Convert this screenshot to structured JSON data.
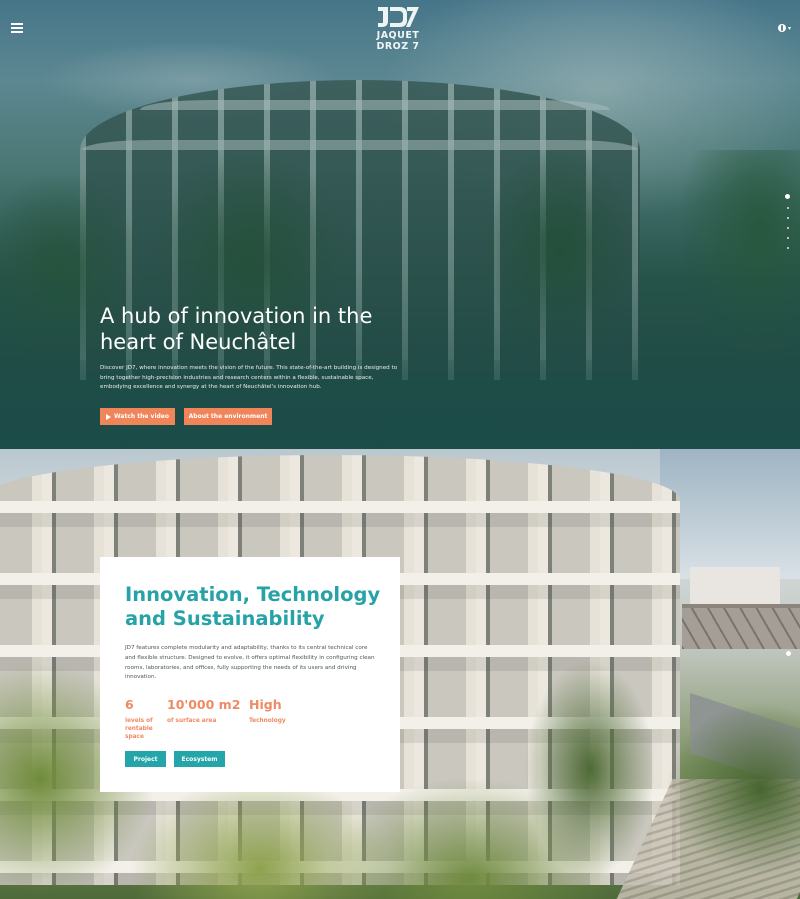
{
  "header": {
    "logo_text_line1": "JAQUET",
    "logo_text_line2": "DROZ 7",
    "menu_icon": "hamburger-menu-icon",
    "language_icon": "globe-icon"
  },
  "hero": {
    "title": "A hub of innovation in the heart of Neuchâtel",
    "description": "Discover JD7, where innovation meets the vision of the future. This state-of-the-art building is designed to bring together high-precision industries and research centers within a flexible, sustainable space, embodying excellence and synergy at the heart of Neuchâtel's innovation hub.",
    "buttons": [
      {
        "label": "Watch the video",
        "icon": "play-icon"
      },
      {
        "label": "About the environment"
      }
    ],
    "slide_count": 6,
    "active_slide": 1
  },
  "innovation": {
    "title": "Innovation, Technology and Sustainability",
    "text": "JD7 features complete modularity and adaptability, thanks to its central technical core and flexible structure. Designed to evolve, it offers optimal flexibility in configuring clean rooms, laboratories, and offices, fully supporting the needs of its users and driving innovation.",
    "stats": [
      {
        "value": "6",
        "label": "levels of rentable space"
      },
      {
        "value": "10'000 m2",
        "label": "of surface area"
      },
      {
        "value": "High",
        "label": "Technology"
      }
    ],
    "buttons": [
      {
        "label": "Project"
      },
      {
        "label": "Ecosystem"
      }
    ]
  },
  "colors": {
    "accent_orange": "#f0855a",
    "accent_teal": "#23a5a9",
    "title_teal": "#27a3a8"
  }
}
